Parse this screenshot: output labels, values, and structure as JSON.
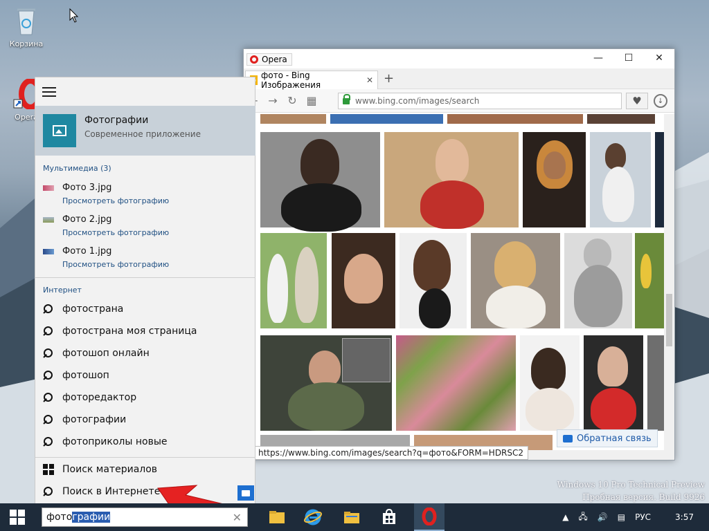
{
  "desktop": {
    "recycle_bin_label": "Корзина",
    "opera_shortcut_label": "Opera",
    "watermark_line1": "Windows 10 Pro Technical Preview",
    "watermark_line2": "Пробная версия. Build 9926"
  },
  "browser": {
    "app_label": "Opera",
    "tab_title": "фото - Bing Изображения",
    "new_tab_label": "+",
    "address": "www.bing.com/images/search",
    "status_url": "https://www.bing.com/images/search?q=фото&FORM=HDRSC2",
    "feedback_label": "Обратная связь"
  },
  "search_panel": {
    "best_match": {
      "name_typed": "Фото",
      "name_rest": "графии",
      "subtitle": "Современное приложение"
    },
    "media_header": "Мультимедиа (3)",
    "media": [
      {
        "name": "Фото 3.jpg",
        "action": "Просмотреть фотографию"
      },
      {
        "name": "Фото 2.jpg",
        "action": "Просмотреть фотографию"
      },
      {
        "name": "Фото 1.jpg",
        "action": "Просмотреть фотографию"
      }
    ],
    "internet_header": "Интернет",
    "suggestions": [
      {
        "typed": "фото",
        "rest": "страна"
      },
      {
        "typed": "фото",
        "rest": "страна моя страница"
      },
      {
        "typed": "фото",
        "rest": "шоп онлайн"
      },
      {
        "typed": "фото",
        "rest": "шоп"
      },
      {
        "typed": "фото",
        "rest": "редактор"
      },
      {
        "typed": "фото",
        "rest": "графии"
      },
      {
        "typed": "фото",
        "rest": " приколы новые"
      }
    ],
    "search_materials": "Поиск материалов",
    "search_web": "Поиск в Интернете"
  },
  "taskbar": {
    "search_typed": "фото",
    "search_selected": "графии",
    "language": "РУС",
    "time": "3:57"
  },
  "colors": {
    "accent_teal": "#1f88a1",
    "opera_red": "#e0211f",
    "taskbar": "#1e2b3a",
    "link_blue": "#1f4f82"
  }
}
